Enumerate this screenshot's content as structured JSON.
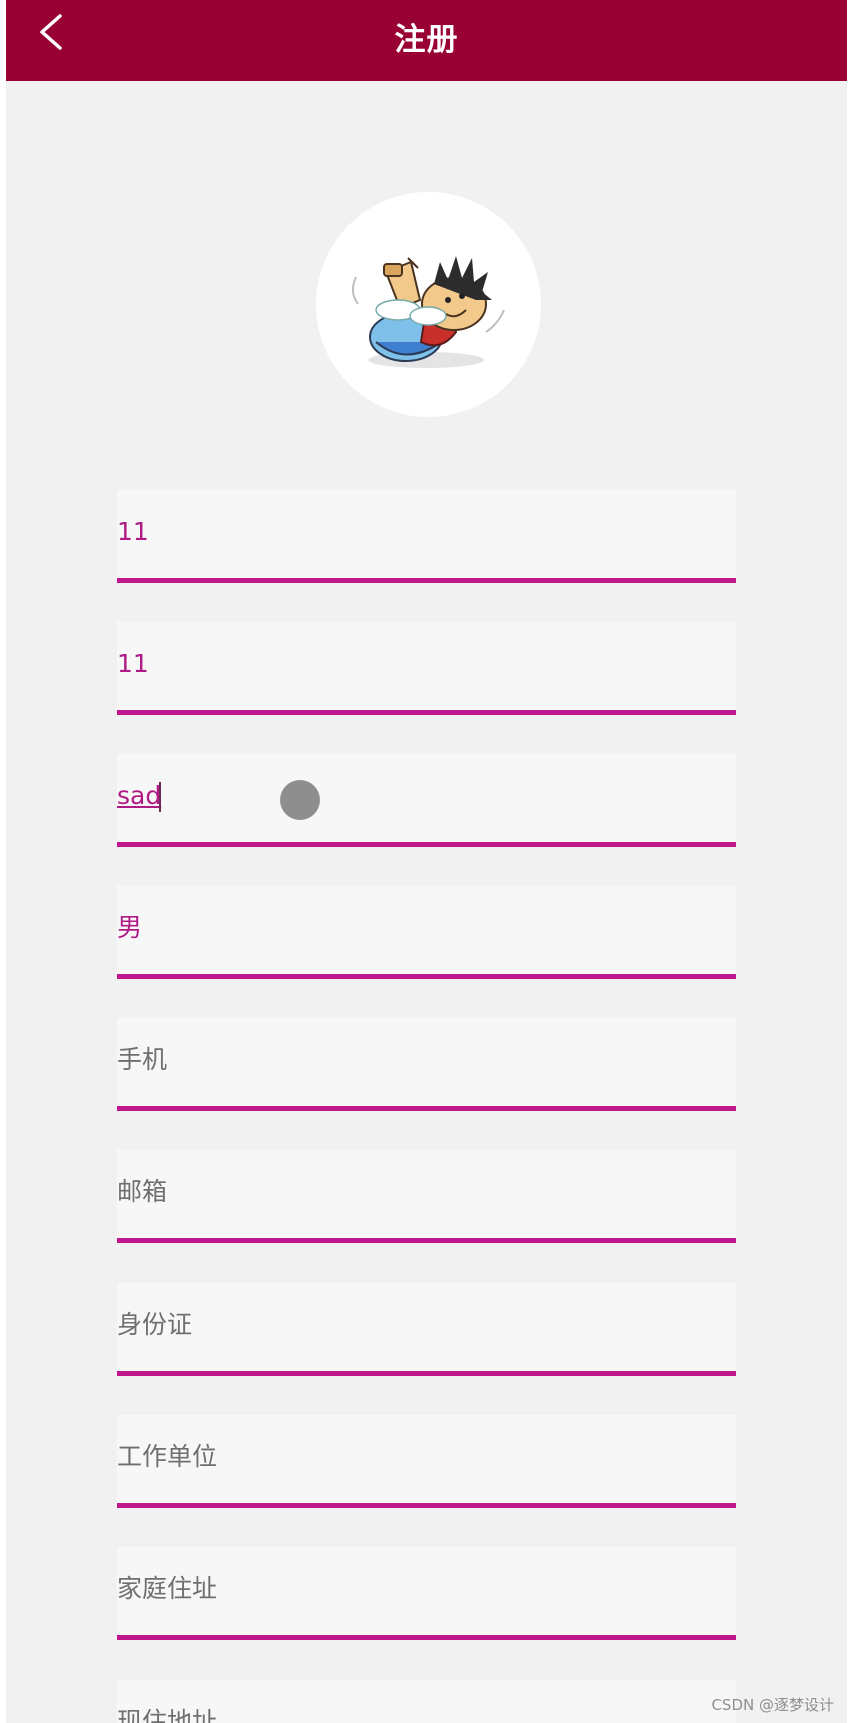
{
  "header": {
    "title": "注册",
    "back_icon": "chevron-left-icon",
    "background_color": "#990033"
  },
  "avatar": {
    "description_icon": "avatar-cartoon-icon"
  },
  "form": {
    "fields": [
      {
        "name": "username",
        "value": "11",
        "placeholder": ""
      },
      {
        "name": "password",
        "value": "11",
        "placeholder": ""
      },
      {
        "name": "real-name",
        "value": "sad",
        "placeholder": ""
      },
      {
        "name": "gender",
        "value": "男",
        "placeholder": ""
      },
      {
        "name": "phone",
        "value": "",
        "placeholder": "手机"
      },
      {
        "name": "email",
        "value": "",
        "placeholder": "邮箱"
      },
      {
        "name": "id-card",
        "value": "",
        "placeholder": "身份证"
      },
      {
        "name": "workplace",
        "value": "",
        "placeholder": "工作单位"
      },
      {
        "name": "home-address",
        "value": "",
        "placeholder": "家庭住址"
      },
      {
        "name": "current-address",
        "value": "",
        "placeholder": "现住地址"
      }
    ],
    "accent_color": "#c0188c",
    "value_color": "#b01a86"
  },
  "watermark": "CSDN @逐梦设计"
}
